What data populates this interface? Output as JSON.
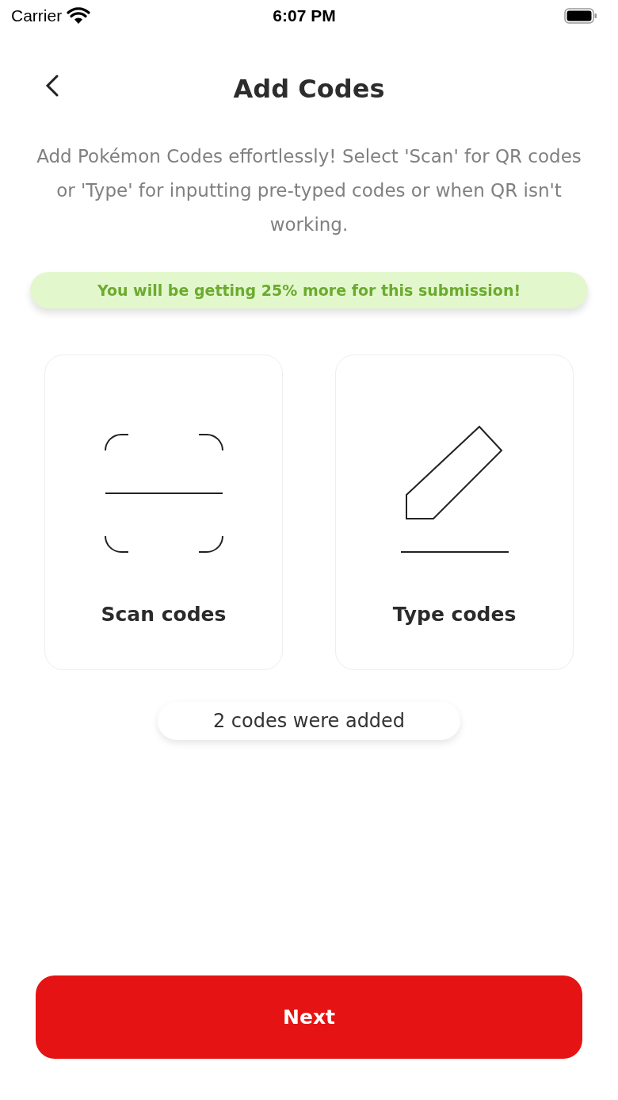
{
  "status_bar": {
    "carrier": "Carrier",
    "time": "6:07 PM"
  },
  "header": {
    "title": "Add Codes"
  },
  "description": "Add Pokémon Codes effortlessly! Select 'Scan' for QR codes or 'Type' for inputting pre-typed codes or when QR isn't working.",
  "bonus_banner": "You will be getting 25% more for this submission!",
  "options": [
    {
      "kind": "scan",
      "label": "Scan codes"
    },
    {
      "kind": "type",
      "label": "Type codes"
    }
  ],
  "added_count": "2 codes were added",
  "next_button": "Next"
}
